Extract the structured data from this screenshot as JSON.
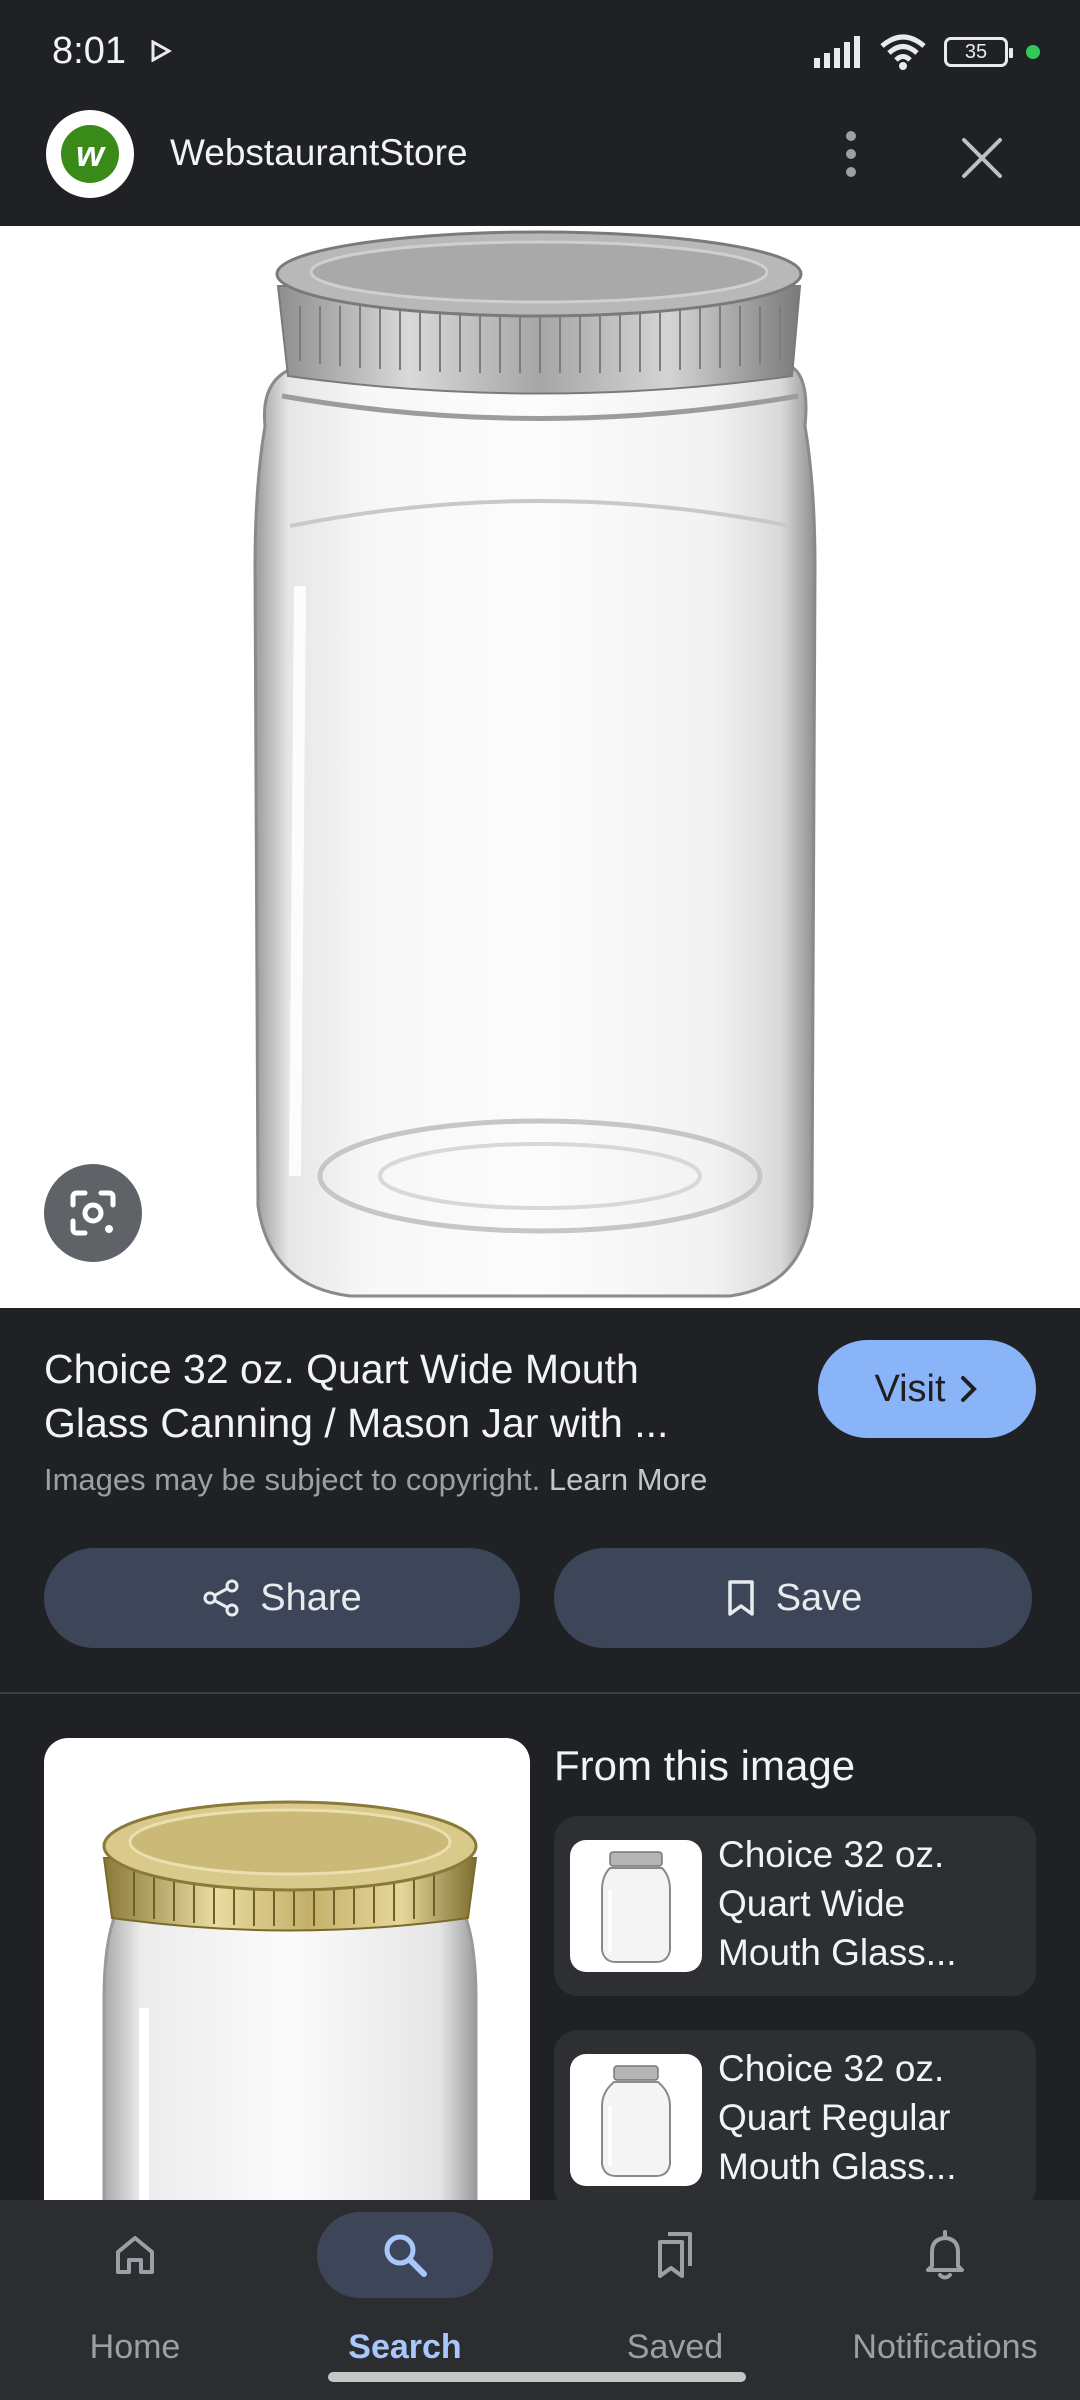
{
  "status_bar": {
    "time": "8:01",
    "battery": "35",
    "icons": [
      "play-store-notification-icon",
      "signal-icon",
      "wifi-icon",
      "battery-icon",
      "privacy-dot-icon"
    ]
  },
  "header": {
    "site_name": "WebstaurantStore",
    "logo_letter": "w",
    "logo_color": "#3a8a1a",
    "icons": [
      "more-vert-icon",
      "close-icon"
    ]
  },
  "hero": {
    "image": "glass-mason-jar-with-silver-lid",
    "lens_icon": "google-lens-icon"
  },
  "result": {
    "title": "Choice 32 oz. Quart Wide Mouth\nGlass Canning / Mason Jar with ...",
    "visit_label": "Visit",
    "copyright_text": "Images may be subject to copyright. ",
    "learn_more": "Learn More",
    "share_label": "Share",
    "save_label": "Save"
  },
  "related": {
    "heading": "From this image",
    "items": [
      {
        "title": "Choice 32 oz.\nQuart Wide\nMouth Glass..."
      },
      {
        "title": "Choice 32 oz.\nQuart Regular\nMouth Glass..."
      }
    ]
  },
  "bottom_nav": {
    "items": [
      {
        "label": "Home",
        "icon": "home-icon"
      },
      {
        "label": "Search",
        "icon": "search-icon",
        "active": true
      },
      {
        "label": "Saved",
        "icon": "saved-collections-icon"
      },
      {
        "label": "Notifications",
        "icon": "bell-icon"
      }
    ],
    "active_color": "#a8c7fa"
  }
}
